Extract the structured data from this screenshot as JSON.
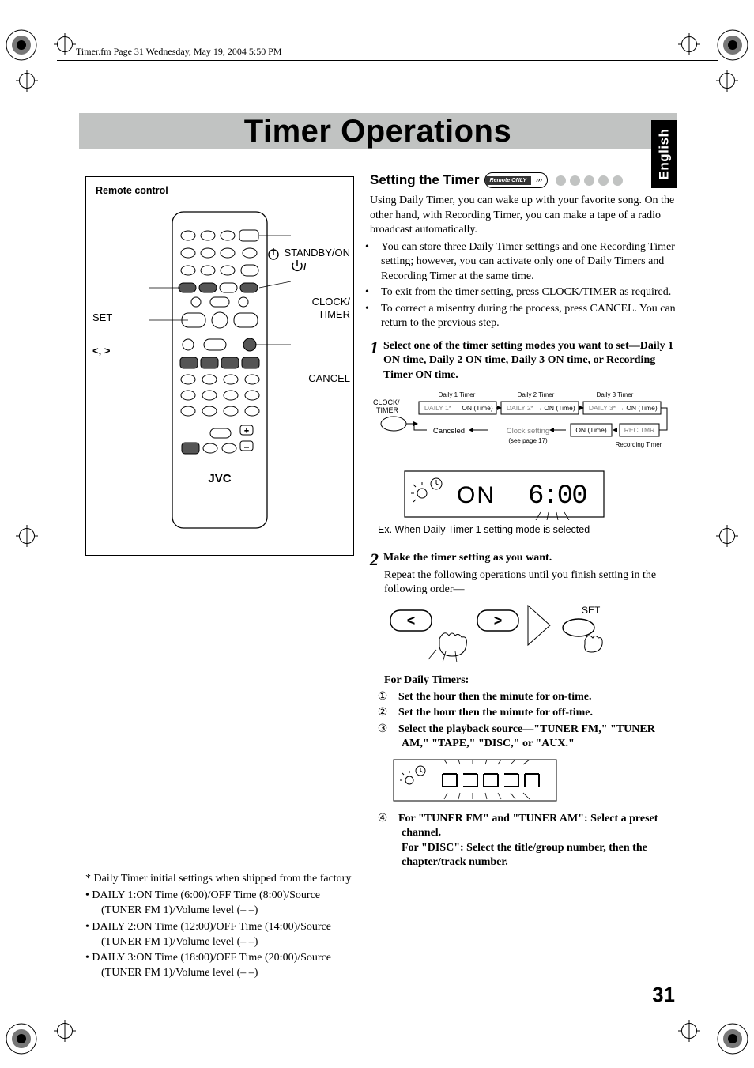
{
  "meta": {
    "header_meta": "Timer.fm  Page 31  Wednesday, May 19, 2004  5:50 PM"
  },
  "title": "Timer Operations",
  "side_tab": "English",
  "remote": {
    "title": "Remote control",
    "labels": {
      "set": "SET",
      "arrows": "<, >",
      "standby": "STANDBY/ON",
      "clock_timer_l1": "CLOCK/",
      "clock_timer_l2": "TIMER",
      "cancel": "CANCEL",
      "brand": "JVC"
    }
  },
  "footnotes": {
    "star": "* Daily Timer initial settings when shipped from the factory",
    "b1": "• DAILY 1:ON Time (6:00)/OFF Time (8:00)/Source (TUNER FM 1)/Volume level (– –)",
    "b2": "• DAILY 2:ON Time (12:00)/OFF Time (14:00)/Source (TUNER FM 1)/Volume level (– –)",
    "b3": "• DAILY 3:ON Time (18:00)/OFF Time (20:00)/Source (TUNER FM 1)/Volume level (– –)"
  },
  "section": {
    "heading": "Setting the Timer",
    "badge_dark": "Remote ONLY",
    "intro": "Using Daily Timer, you can wake up with your favorite song. On the other hand, with Recording Timer, you can make a tape of a radio broadcast automatically.",
    "bullets": [
      "You can store three Daily Timer settings and one Recording Timer setting; however, you can activate only one of Daily Timers and Recording Timer at the same time.",
      "To exit from the timer setting, press CLOCK/TIMER as required.",
      "To correct a misentry during the process, press CANCEL. You can return to the previous step."
    ],
    "step1": {
      "num": "1",
      "text": "Select one of the timer setting modes you want to set—Daily 1 ON time, Daily 2 ON time, Daily 3 ON time, or Recording Timer ON time.",
      "flow": {
        "clock_timer_l1": "CLOCK/",
        "clock_timer_l2": "TIMER",
        "daily1_top": "Daily 1 Timer",
        "daily2_top": "Daily 2 Timer",
        "daily3_top": "Daily 3 Timer",
        "daily1": "DAILY 1*",
        "daily2": "DAILY 2*",
        "daily3": "DAILY 3*",
        "on_time": "ON (Time)",
        "canceled": "Canceled",
        "clock_setting": "Clock setting",
        "see_page": "(see page 17)",
        "rec_tmr": "REC TMR",
        "rec_timer_lbl": "Recording Timer"
      },
      "display_on": "ON",
      "display_time": "6:00",
      "caption": "Ex. When Daily Timer 1 setting mode is selected"
    },
    "step2": {
      "num": "2",
      "title": "Make the timer setting as you want.",
      "body": "Repeat the following operations until you finish setting in the following order—",
      "set_label": "SET",
      "daily_head": "For Daily Timers:",
      "items": [
        "Set the hour then the minute for on-time.",
        "Set the hour then the minute for off-time.",
        "Select the playback source—\"TUNER FM,\" \"TUNER AM,\" \"TAPE,\" \"DISC,\" or \"AUX.\""
      ],
      "item4_l1": "For \"TUNER FM\" and \"TUNER AM\": Select a preset channel.",
      "item4_l2": "For \"DISC\": Select the title/group number, then the chapter/track number."
    }
  },
  "page_number": "31"
}
